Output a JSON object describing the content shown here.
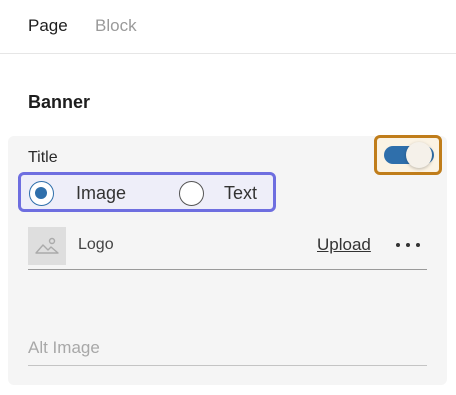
{
  "tabs": [
    {
      "label": "Page",
      "active": true
    },
    {
      "label": "Block",
      "active": false
    }
  ],
  "section": {
    "title": "Banner"
  },
  "card": {
    "field_label": "Title",
    "toggle": {
      "on": true,
      "track_color": "#2f6fab",
      "highlight_color": "#c07d1a"
    },
    "radio_group": {
      "highlight_color": "#6e6ee0",
      "options": [
        {
          "label": "Image",
          "checked": true
        },
        {
          "label": "Text",
          "checked": false
        }
      ]
    },
    "logo": {
      "label": "Logo",
      "thumbnail_icon": "image-placeholder-icon",
      "upload_label": "Upload",
      "more_icon": "more-horizontal-icon"
    },
    "alt_input": {
      "value": "",
      "placeholder": "Alt Image"
    }
  }
}
